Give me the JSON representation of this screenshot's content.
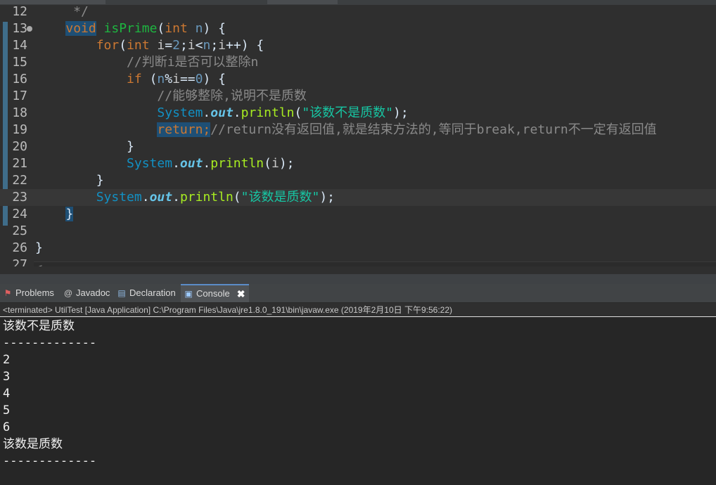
{
  "editor": {
    "lines": [
      {
        "no": "12",
        "segs": [
          {
            "t": "     */",
            "c": "cmt"
          }
        ]
      },
      {
        "no": "13",
        "segs": [
          {
            "t": "    ",
            "c": "id"
          },
          {
            "t": "void",
            "c": "kw hl"
          },
          {
            "t": " ",
            "c": "id"
          },
          {
            "t": "isPrime",
            "c": "fn"
          },
          {
            "t": "(",
            "c": "plain"
          },
          {
            "t": "int",
            "c": "kw"
          },
          {
            "t": " ",
            "c": "id"
          },
          {
            "t": "n",
            "c": "var"
          },
          {
            "t": ") {",
            "c": "plain"
          }
        ]
      },
      {
        "no": "14",
        "segs": [
          {
            "t": "        ",
            "c": "id"
          },
          {
            "t": "for",
            "c": "kw"
          },
          {
            "t": "(",
            "c": "plain"
          },
          {
            "t": "int",
            "c": "kw"
          },
          {
            "t": " ",
            "c": "id"
          },
          {
            "t": "i",
            "c": "id"
          },
          {
            "t": "=",
            "c": "plain"
          },
          {
            "t": "2",
            "c": "num"
          },
          {
            "t": ";",
            "c": "plain"
          },
          {
            "t": "i",
            "c": "id"
          },
          {
            "t": "<",
            "c": "plain"
          },
          {
            "t": "n",
            "c": "var"
          },
          {
            "t": ";",
            "c": "plain"
          },
          {
            "t": "i",
            "c": "id"
          },
          {
            "t": "++) {",
            "c": "plain"
          }
        ]
      },
      {
        "no": "15",
        "segs": [
          {
            "t": "            ",
            "c": "id"
          },
          {
            "t": "//判断i是否可以整除n",
            "c": "cmt"
          }
        ]
      },
      {
        "no": "16",
        "segs": [
          {
            "t": "            ",
            "c": "id"
          },
          {
            "t": "if",
            "c": "kw"
          },
          {
            "t": " (",
            "c": "plain"
          },
          {
            "t": "n",
            "c": "var"
          },
          {
            "t": "%",
            "c": "plain"
          },
          {
            "t": "i",
            "c": "id"
          },
          {
            "t": "==",
            "c": "plain"
          },
          {
            "t": "0",
            "c": "num"
          },
          {
            "t": ") {",
            "c": "plain"
          }
        ]
      },
      {
        "no": "17",
        "segs": [
          {
            "t": "                ",
            "c": "id"
          },
          {
            "t": "//能够整除,说明不是质数",
            "c": "cmt"
          }
        ]
      },
      {
        "no": "18",
        "segs": [
          {
            "t": "                ",
            "c": "id"
          },
          {
            "t": "System",
            "c": "cls"
          },
          {
            "t": ".",
            "c": "plain"
          },
          {
            "t": "out",
            "c": "fld"
          },
          {
            "t": ".",
            "c": "plain"
          },
          {
            "t": "println",
            "c": "mth"
          },
          {
            "t": "(",
            "c": "plain"
          },
          {
            "t": "\"该数不是质数\"",
            "c": "str"
          },
          {
            "t": ");",
            "c": "plain"
          }
        ]
      },
      {
        "no": "19",
        "segs": [
          {
            "t": "                ",
            "c": "id"
          },
          {
            "t": "return;",
            "c": "kw hl"
          },
          {
            "t": "//return没有返回值,就是结束方法的,等同于break,return不一定有返回值",
            "c": "cmt"
          }
        ]
      },
      {
        "no": "20",
        "segs": [
          {
            "t": "            }",
            "c": "plain"
          }
        ]
      },
      {
        "no": "21",
        "segs": [
          {
            "t": "            ",
            "c": "id"
          },
          {
            "t": "System",
            "c": "cls"
          },
          {
            "t": ".",
            "c": "plain"
          },
          {
            "t": "out",
            "c": "fld"
          },
          {
            "t": ".",
            "c": "plain"
          },
          {
            "t": "println",
            "c": "mth"
          },
          {
            "t": "(",
            "c": "plain"
          },
          {
            "t": "i",
            "c": "id"
          },
          {
            "t": ");",
            "c": "plain"
          }
        ]
      },
      {
        "no": "22",
        "segs": [
          {
            "t": "        }",
            "c": "plain"
          }
        ]
      },
      {
        "no": "23",
        "segs": [
          {
            "t": "        ",
            "c": "id"
          },
          {
            "t": "System",
            "c": "cls"
          },
          {
            "t": ".",
            "c": "plain"
          },
          {
            "t": "out",
            "c": "fld"
          },
          {
            "t": ".",
            "c": "plain"
          },
          {
            "t": "println",
            "c": "mth"
          },
          {
            "t": "(",
            "c": "plain"
          },
          {
            "t": "\"该数是质数\"",
            "c": "str"
          },
          {
            "t": ");",
            "c": "plain"
          }
        ]
      },
      {
        "no": "24",
        "segs": [
          {
            "t": "    ",
            "c": "id"
          },
          {
            "t": "}",
            "c": "plain hl"
          }
        ]
      },
      {
        "no": "25",
        "segs": []
      },
      {
        "no": "26",
        "segs": [
          {
            "t": "}",
            "c": "plain"
          }
        ]
      },
      {
        "no": "27",
        "segs": []
      }
    ]
  },
  "views": {
    "tabs": [
      {
        "label": "Problems",
        "icon": "problems-icon"
      },
      {
        "label": "Javadoc",
        "icon": "javadoc-icon"
      },
      {
        "label": "Declaration",
        "icon": "declaration-icon"
      },
      {
        "label": "Console",
        "icon": "console-icon",
        "active": true
      }
    ],
    "close_glyph": "✖"
  },
  "console": {
    "header": "<terminated> UtilTest [Java Application] C:\\Program Files\\Java\\jre1.8.0_191\\bin\\javaw.exe (2019年2月10日 下午9:56:22)",
    "output": [
      "该数不是质数",
      "-------------",
      "2",
      "3",
      "4",
      "5",
      "6",
      "该数是质数",
      "-------------"
    ]
  }
}
